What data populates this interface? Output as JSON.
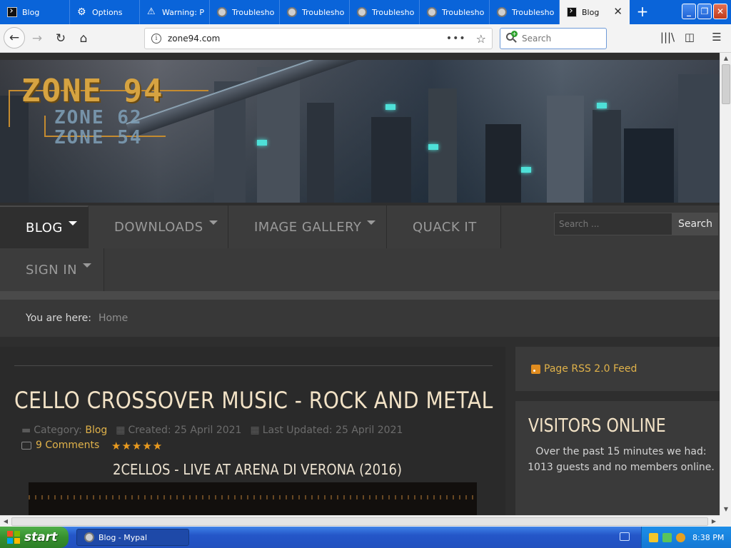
{
  "browser": {
    "tabs": [
      {
        "label": "Blog",
        "icon": "terminal-icon"
      },
      {
        "label": "Options",
        "icon": "gear-icon"
      },
      {
        "label": "Warning: P",
        "icon": "warning-icon"
      },
      {
        "label": "Troubleshoo",
        "icon": "duck-icon"
      },
      {
        "label": "Troubleshoo",
        "icon": "duck-icon"
      },
      {
        "label": "Troubleshoo",
        "icon": "duck-icon"
      },
      {
        "label": "Troubleshoo",
        "icon": "duck-icon"
      },
      {
        "label": "Troubleshoo",
        "icon": "duck-icon"
      },
      {
        "label": "Blog",
        "icon": "terminal-icon",
        "active": true
      }
    ],
    "new_tab_symbol": "+",
    "url": "zone94.com",
    "search_placeholder": "Search"
  },
  "site": {
    "logo_main": "ZONE 94",
    "logo_sub1": "ZONE 62",
    "logo_sub2": "ZONE 54",
    "menu": [
      {
        "label": "BLOG",
        "active": true,
        "dropdown": true
      },
      {
        "label": "DOWNLOADS",
        "dropdown": true
      },
      {
        "label": "IMAGE GALLERY",
        "dropdown": true
      },
      {
        "label": "QUACK IT",
        "dropdown": false
      },
      {
        "label": "SIGN IN",
        "dropdown": true
      }
    ],
    "search_placeholder": "Search ...",
    "search_button": "Search",
    "breadcrumb": {
      "prefix": "You are here:",
      "home": "Home"
    }
  },
  "article": {
    "title": "CELLO CROSSOVER MUSIC - ROCK AND METAL",
    "category_label": "Category:",
    "category": "Blog",
    "created": "Created: 25 April 2021",
    "updated": "Last Updated: 25 April 2021",
    "comments": "9 Comments",
    "rating_stars": 5,
    "subtitle": "2CELLOS - LIVE AT ARENA DI VERONA (2016)"
  },
  "sidebar": {
    "rss": "Page RSS 2.0 Feed",
    "visitors_title": "VISITORS ONLINE",
    "visitors_text": "Over the past 15 minutes we had: 1013 guests and no members online."
  },
  "taskbar": {
    "start": "start",
    "task_label": "Blog - Mypal",
    "clock": "8:38 PM"
  },
  "colors": {
    "tab_strip": "#0a64d9",
    "accent_gold": "#e0b24a",
    "title_cream": "#f2e2c6",
    "page_bg": "#2e2e2e",
    "taskbar_blue": "#2456c8",
    "start_green": "#36902f"
  }
}
